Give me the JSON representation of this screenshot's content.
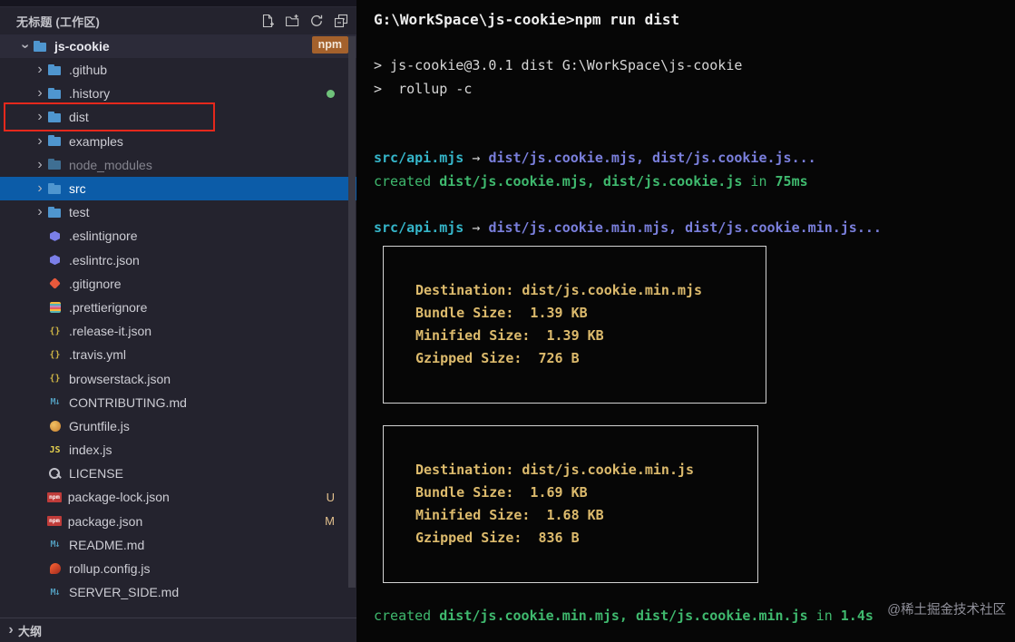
{
  "explorer": {
    "header": {
      "title": "无标题 (工作区)",
      "tools": [
        "new-file",
        "new-folder",
        "refresh",
        "collapse-all"
      ]
    },
    "root": {
      "label": "js-cookie",
      "badge": "npm"
    },
    "items": [
      {
        "label": ".github",
        "type": "folder"
      },
      {
        "label": ".history",
        "type": "folder",
        "dot": true
      },
      {
        "label": "dist",
        "type": "folder",
        "annotated": true
      },
      {
        "label": "examples",
        "type": "folder"
      },
      {
        "label": "node_modules",
        "type": "folder",
        "dimmed": true
      },
      {
        "label": "src",
        "type": "folder",
        "selected": true
      },
      {
        "label": "test",
        "type": "folder"
      },
      {
        "label": ".eslintignore",
        "type": "file",
        "icon": "eslint"
      },
      {
        "label": ".eslintrc.json",
        "type": "file",
        "icon": "eslint"
      },
      {
        "label": ".gitignore",
        "type": "file",
        "icon": "git"
      },
      {
        "label": ".prettierignore",
        "type": "file",
        "icon": "prettier"
      },
      {
        "label": ".release-it.json",
        "type": "file",
        "icon": "json"
      },
      {
        "label": ".travis.yml",
        "type": "file",
        "icon": "json"
      },
      {
        "label": "browserstack.json",
        "type": "file",
        "icon": "json"
      },
      {
        "label": "CONTRIBUTING.md",
        "type": "file",
        "icon": "markdown"
      },
      {
        "label": "Gruntfile.js",
        "type": "file",
        "icon": "grunt"
      },
      {
        "label": "index.js",
        "type": "file",
        "icon": "js"
      },
      {
        "label": "LICENSE",
        "type": "file",
        "icon": "license"
      },
      {
        "label": "package-lock.json",
        "type": "file",
        "icon": "npm",
        "badge": "U"
      },
      {
        "label": "package.json",
        "type": "file",
        "icon": "npm",
        "badge": "M"
      },
      {
        "label": "README.md",
        "type": "file",
        "icon": "markdown"
      },
      {
        "label": "rollup.config.js",
        "type": "file",
        "icon": "rollup"
      },
      {
        "label": "SERVER_SIDE.md",
        "type": "file",
        "icon": "markdown"
      }
    ],
    "outline_label": "大纲"
  },
  "terminal": {
    "lines": [
      {
        "type": "text",
        "segments": [
          {
            "t": "G:\\WorkSpace\\js-cookie>npm run dist",
            "c": "whiteb"
          }
        ]
      },
      {
        "type": "blank"
      },
      {
        "type": "text",
        "segments": [
          {
            "t": "> js-cookie@3.0.1 dist G:\\WorkSpace\\js-cookie",
            "c": "white"
          }
        ]
      },
      {
        "type": "text",
        "segments": [
          {
            "t": ">  rollup -c",
            "c": "white"
          }
        ]
      },
      {
        "type": "blank"
      },
      {
        "type": "blank"
      },
      {
        "type": "text",
        "segments": [
          {
            "t": "src/api.mjs",
            "c": "cyan"
          },
          {
            "t": " → ",
            "c": "dim"
          },
          {
            "t": "dist/js.cookie.mjs, dist/js.cookie.js",
            "c": "purple"
          },
          {
            "t": "...",
            "c": "purple"
          }
        ]
      },
      {
        "type": "text",
        "segments": [
          {
            "t": "created ",
            "c": "green"
          },
          {
            "t": "dist/js.cookie.mjs, dist/js.cookie.js",
            "c": "greenb"
          },
          {
            "t": " in ",
            "c": "green"
          },
          {
            "t": "75ms",
            "c": "greenb"
          }
        ]
      },
      {
        "type": "blank"
      },
      {
        "type": "text",
        "segments": [
          {
            "t": "src/api.mjs",
            "c": "cyan"
          },
          {
            "t": " → ",
            "c": "dim"
          },
          {
            "t": "dist/js.cookie.min.mjs, dist/js.cookie.min.js",
            "c": "purple"
          },
          {
            "t": "...",
            "c": "purple"
          }
        ]
      },
      {
        "type": "box",
        "rows": [
          {
            "label": "Destination:",
            "value": " dist/js.cookie.min.mjs"
          },
          {
            "label": "Bundle Size:",
            "value": "  1.39 KB"
          },
          {
            "label": "Minified Size:",
            "value": "  1.39 KB"
          },
          {
            "label": "Gzipped Size:",
            "value": "  726 B"
          }
        ]
      },
      {
        "type": "box",
        "rows": [
          {
            "label": "Destination:",
            "value": " dist/js.cookie.min.js"
          },
          {
            "label": "Bundle Size:",
            "value": "  1.69 KB"
          },
          {
            "label": "Minified Size:",
            "value": "  1.68 KB"
          },
          {
            "label": "Gzipped Size:",
            "value": "  836 B"
          }
        ]
      },
      {
        "type": "text",
        "segments": [
          {
            "t": "created ",
            "c": "green"
          },
          {
            "t": "dist/js.cookie.min.mjs, dist/js.cookie.min.js",
            "c": "greenb"
          },
          {
            "t": " in ",
            "c": "green"
          },
          {
            "t": "1.4s",
            "c": "greenb"
          }
        ]
      }
    ]
  },
  "watermark": "@稀土掘金技术社区",
  "colors": {
    "selection_blue": "#0c5ca8",
    "annotation_red": "#e5281c",
    "npm_badge_bg": "#a4612c",
    "git_badge": "#e2c08d",
    "terminal_green": "#3fb96e",
    "terminal_cyan": "#35b5c9",
    "terminal_gold": "#dcba6c",
    "terminal_purple": "#7a7fdc"
  }
}
